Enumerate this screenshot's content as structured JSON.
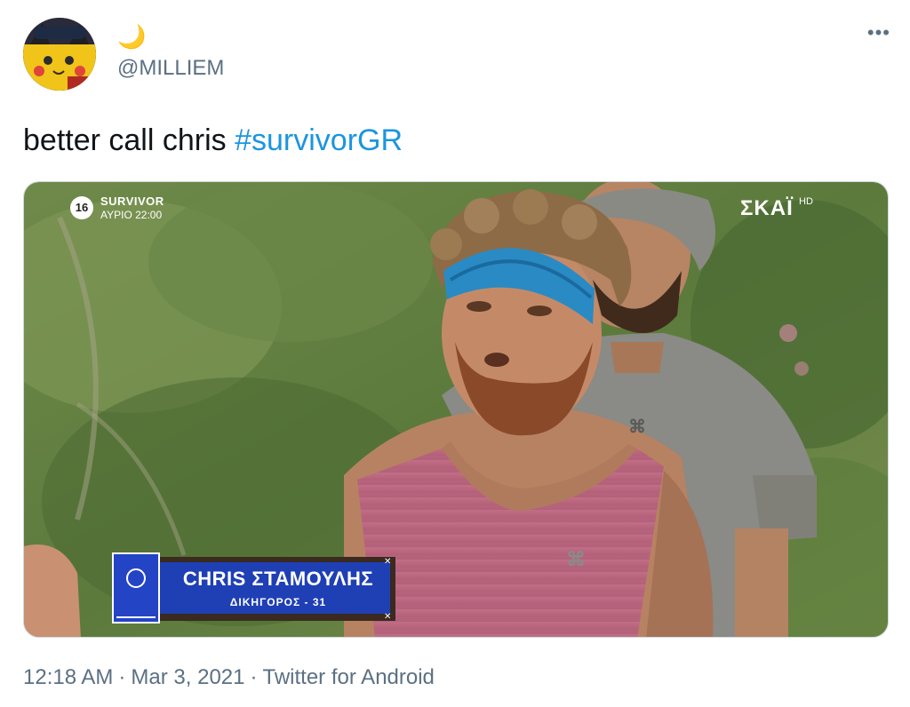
{
  "header": {
    "emoji": "🌙",
    "handle": "@MILLIEM",
    "more_label": "•••"
  },
  "tweet": {
    "text_plain": "better call chris ",
    "hashtag": "#survivorGR"
  },
  "media": {
    "channel_badge": "16",
    "promo_title": "SURVIVOR",
    "promo_time": "ΑΥΡΙΟ 22:00",
    "network_logo": "ΣΚΑΪ",
    "network_hd": "HD",
    "lower_third_name": "CHRIS ΣΤΑΜΟΥΛΗΣ",
    "lower_third_sub": "ΔΙΚΗΓΟΡΟΣ - 31"
  },
  "footer": {
    "time": "12:18 AM",
    "date": "Mar 3, 2021",
    "client": "Twitter for Android"
  },
  "colors": {
    "hashtag": "#1b95e0",
    "secondary_text": "#5b7083",
    "primary_text": "#0f1419"
  }
}
